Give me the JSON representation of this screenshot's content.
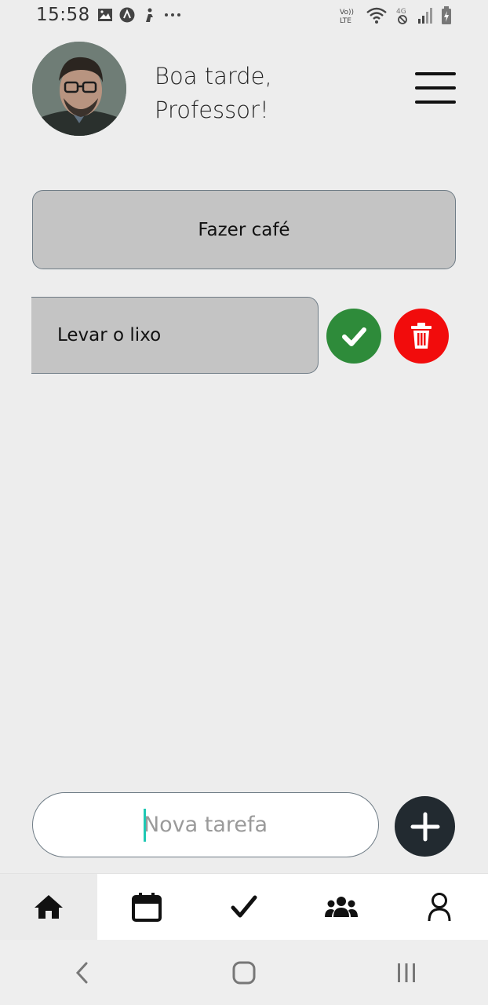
{
  "status_bar": {
    "time": "15:58",
    "left_icons": [
      "image-icon",
      "a-icon",
      "person-icon",
      "more-icon"
    ],
    "right_icons": [
      "volte-icon",
      "wifi-icon",
      "4g-icon",
      "signal-icon",
      "battery-icon"
    ],
    "volte_label": "Vo))\nLTE",
    "network_label": "4G"
  },
  "header": {
    "greeting_line1": "Boa tarde,",
    "greeting_line2": "Professor!"
  },
  "tasks": [
    {
      "label": "Fazer café"
    },
    {
      "label": "Levar o lixo"
    }
  ],
  "new_task": {
    "placeholder": "Nova tarefa",
    "value": ""
  },
  "bottom_nav": {
    "items": [
      "home-icon",
      "calendar-icon",
      "check-icon",
      "group-icon",
      "user-icon"
    ],
    "active": "home-icon"
  },
  "colors": {
    "complete": "#2e8b3a",
    "delete": "#f20c0c",
    "add": "#222a30",
    "task_bg": "#c4c4c4"
  }
}
